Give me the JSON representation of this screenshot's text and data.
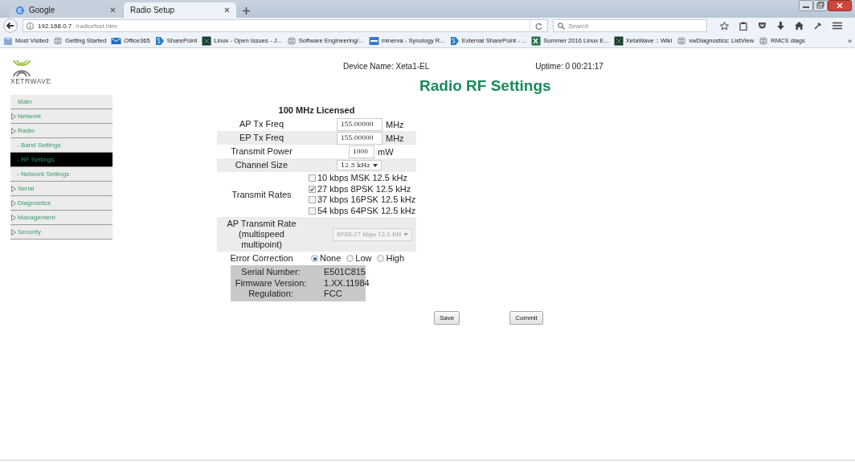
{
  "browser": {
    "tabs": [
      {
        "title": "Google",
        "selected": false
      },
      {
        "title": "Radio Setup",
        "selected": true
      }
    ],
    "url": {
      "host": "192.168.0.7",
      "path": "/radiorfset.htm"
    },
    "search": {
      "placeholder": "Search"
    },
    "bookmarks": [
      {
        "label": "Most Visited",
        "kind": "folder"
      },
      {
        "label": "Getting Started",
        "kind": "globe"
      },
      {
        "label": "Office365",
        "kind": "mail"
      },
      {
        "label": "SharePoint",
        "kind": "share"
      },
      {
        "label": "Linux - Open Issues - J...",
        "kind": "tile"
      },
      {
        "label": "Software Engineering/...",
        "kind": "globe"
      },
      {
        "label": "minerva - Synology R...",
        "kind": "nas"
      },
      {
        "label": "External SharePoint - ...",
        "kind": "share"
      },
      {
        "label": "Summer 2016 Linux E...",
        "kind": "excel"
      },
      {
        "label": "XetaWave :: Wiki",
        "kind": "tile"
      },
      {
        "label": "xwDiagnostics: ListView",
        "kind": "globe"
      },
      {
        "label": "RMCS diags",
        "kind": "globe"
      }
    ],
    "bookmarks_overflow": "»"
  },
  "page": {
    "logo_text": "XETRWAVE",
    "device_name": "Device Name: Xeta1-EL",
    "uptime": "Uptime: 0 00:21:17",
    "title": "Radio RF Settings",
    "nav": [
      {
        "label": "Main",
        "kind": "top",
        "selected": false
      },
      {
        "label": "Network",
        "kind": "group",
        "selected": false
      },
      {
        "label": "Radio",
        "kind": "group",
        "selected": false
      },
      {
        "label": "-  Band Settings",
        "kind": "sub",
        "selected": false
      },
      {
        "label": "-  RF Settings",
        "kind": "sub",
        "selected": true
      },
      {
        "label": "-  Network Settings",
        "kind": "sub",
        "selected": false
      },
      {
        "label": "Serial",
        "kind": "group",
        "selected": false
      },
      {
        "label": "Diagnostics",
        "kind": "group",
        "selected": false
      },
      {
        "label": "Management",
        "kind": "group",
        "selected": false
      },
      {
        "label": "Security",
        "kind": "group",
        "selected": false
      }
    ],
    "form_heading": "100 MHz Licensed",
    "form": [
      {
        "kind": "input",
        "label": "AP Tx Freq",
        "value": "155.00000",
        "unit": "MHz"
      },
      {
        "kind": "input",
        "label": "EP Tx Freq",
        "value": "155.00000",
        "unit": "MHz"
      },
      {
        "kind": "input",
        "label": "Transmit Power",
        "value": "1000",
        "unit": "mW"
      },
      {
        "kind": "select",
        "label": "Channel Size",
        "value": "12.5 kHz",
        "disabled": false
      },
      {
        "kind": "checkboxes",
        "label": "Transmit Rates",
        "options": [
          {
            "label": "10 kbps MSK 12.5 kHz",
            "checked": false
          },
          {
            "label": "27 kbps 8PSK 12.5 kHz",
            "checked": true
          },
          {
            "label": "37 kbps 16PSK 12.5 kHz",
            "checked": false
          },
          {
            "label": "54 kbps 64PSK 12.5 kHz",
            "checked": false
          }
        ]
      },
      {
        "kind": "select",
        "label": "AP Transmit Rate (multispeed multipoint)",
        "value": "8PSK-27 kbps 12.5 KH",
        "disabled": true
      },
      {
        "kind": "radios",
        "label": "Error Correction",
        "options": [
          {
            "label": "None",
            "selected": true
          },
          {
            "label": "Low",
            "selected": false
          },
          {
            "label": "High",
            "selected": false
          }
        ]
      }
    ],
    "info": [
      {
        "label": "Serial Number:",
        "value": "E501C815"
      },
      {
        "label": "Firmware Version:",
        "value": "1.XX.11984"
      },
      {
        "label": "Regulation:",
        "value": "FCC"
      }
    ],
    "buttons": [
      "Save",
      "Commit"
    ]
  }
}
